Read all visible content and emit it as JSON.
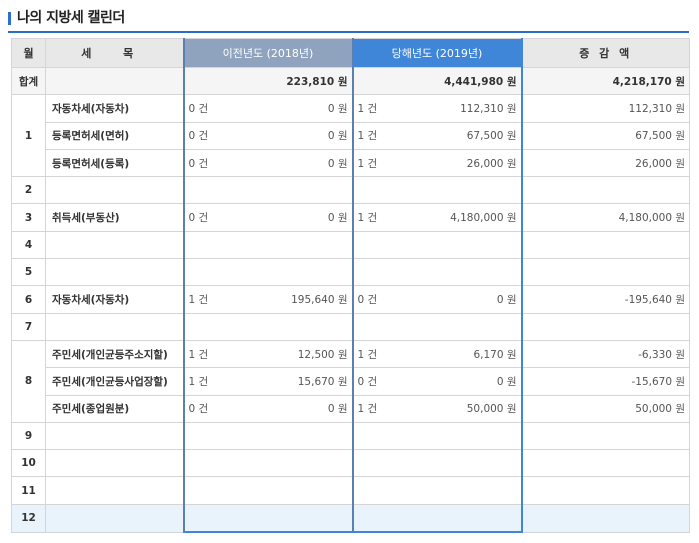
{
  "title": "나의 지방세 캘린더",
  "headers": {
    "month": "월",
    "item": "세 목",
    "prev": "이전년도 (2018년)",
    "curr": "당해년도 (2019년)",
    "diff": "증 감 액"
  },
  "total": {
    "label": "합계",
    "prev_amt": "223,810 원",
    "curr_amt": "4,441,980 원",
    "diff": "4,218,170 원"
  },
  "rows": [
    {
      "month": "1",
      "item": "자동차세(자동차)",
      "prev_cnt": "0 건",
      "prev_amt": "0 원",
      "curr_cnt": "1 건",
      "curr_amt": "112,310 원",
      "diff": "112,310 원"
    },
    {
      "month": "",
      "item": "등록면허세(면허)",
      "prev_cnt": "0 건",
      "prev_amt": "0 원",
      "curr_cnt": "1 건",
      "curr_amt": "67,500 원",
      "diff": "67,500 원"
    },
    {
      "month": "",
      "item": "등록면허세(등록)",
      "prev_cnt": "0 건",
      "prev_amt": "0 원",
      "curr_cnt": "1 건",
      "curr_amt": "26,000 원",
      "diff": "26,000 원"
    },
    {
      "month": "2",
      "item": "",
      "prev_cnt": "",
      "prev_amt": "",
      "curr_cnt": "",
      "curr_amt": "",
      "diff": ""
    },
    {
      "month": "3",
      "item": "취득세(부동산)",
      "prev_cnt": "0 건",
      "prev_amt": "0 원",
      "curr_cnt": "1 건",
      "curr_amt": "4,180,000 원",
      "diff": "4,180,000 원"
    },
    {
      "month": "4",
      "item": "",
      "prev_cnt": "",
      "prev_amt": "",
      "curr_cnt": "",
      "curr_amt": "",
      "diff": ""
    },
    {
      "month": "5",
      "item": "",
      "prev_cnt": "",
      "prev_amt": "",
      "curr_cnt": "",
      "curr_amt": "",
      "diff": ""
    },
    {
      "month": "6",
      "item": "자동차세(자동차)",
      "prev_cnt": "1 건",
      "prev_amt": "195,640 원",
      "curr_cnt": "0 건",
      "curr_amt": "0 원",
      "diff": "-195,640 원"
    },
    {
      "month": "7",
      "item": "",
      "prev_cnt": "",
      "prev_amt": "",
      "curr_cnt": "",
      "curr_amt": "",
      "diff": ""
    },
    {
      "month": "8",
      "item": "주민세(개인균등주소지할)",
      "prev_cnt": "1 건",
      "prev_amt": "12,500 원",
      "curr_cnt": "1 건",
      "curr_amt": "6,170 원",
      "diff": "-6,330 원"
    },
    {
      "month": "",
      "item": "주민세(개인균등사업장할)",
      "prev_cnt": "1 건",
      "prev_amt": "15,670 원",
      "curr_cnt": "0 건",
      "curr_amt": "0 원",
      "diff": "-15,670 원"
    },
    {
      "month": "",
      "item": "주민세(종업원분)",
      "prev_cnt": "0 건",
      "prev_amt": "0 원",
      "curr_cnt": "1 건",
      "curr_amt": "50,000 원",
      "diff": "50,000 원"
    },
    {
      "month": "9",
      "item": "",
      "prev_cnt": "",
      "prev_amt": "",
      "curr_cnt": "",
      "curr_amt": "",
      "diff": ""
    },
    {
      "month": "10",
      "item": "",
      "prev_cnt": "",
      "prev_amt": "",
      "curr_cnt": "",
      "curr_amt": "",
      "diff": ""
    },
    {
      "month": "11",
      "item": "",
      "prev_cnt": "",
      "prev_amt": "",
      "curr_cnt": "",
      "curr_amt": "",
      "diff": ""
    },
    {
      "month": "12",
      "item": "",
      "prev_cnt": "",
      "prev_amt": "",
      "curr_cnt": "",
      "curr_amt": "",
      "diff": ""
    }
  ]
}
